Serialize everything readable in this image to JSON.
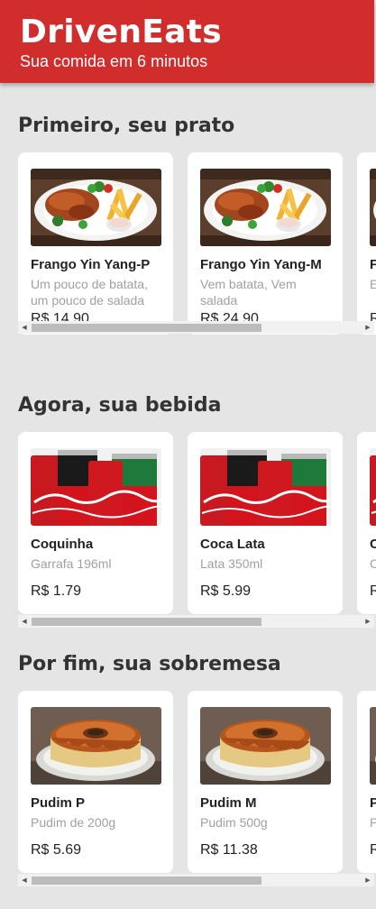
{
  "header": {
    "brand": "DrivenEats",
    "tagline": "Sua comida em 6 minutos"
  },
  "sections": [
    {
      "title": "Primeiro, seu prato",
      "items": [
        {
          "name": "Frango Yin Yang-P",
          "description": "Um pouco de batata, um pouco de salada",
          "price": "R$ 14.90",
          "image": "chicken-plate"
        },
        {
          "name": "Frango Yin Yang-M",
          "description": "Vem batata, Vem salada",
          "price": "R$ 24.90",
          "image": "chicken-plate"
        },
        {
          "name": "F",
          "description": "E b",
          "price": "R",
          "image": "chicken-plate"
        }
      ]
    },
    {
      "title": "Agora, sua bebida",
      "items": [
        {
          "name": "Coquinha",
          "description": "Garrafa 196ml",
          "price": "R$ 1.79",
          "image": "coke-cans"
        },
        {
          "name": "Coca Lata",
          "description": "Lata 350ml",
          "price": "R$ 5.99",
          "image": "coke-cans"
        },
        {
          "name": "C",
          "description": "C",
          "price": "R",
          "image": "coke-cans"
        }
      ]
    },
    {
      "title": "Por fim, sua sobremesa",
      "items": [
        {
          "name": "Pudim P",
          "description": "Pudim de 200g",
          "price": "R$ 5.69",
          "image": "pudding"
        },
        {
          "name": "Pudim M",
          "description": "Pudim 500g",
          "price": "R$ 11.38",
          "image": "pudding"
        },
        {
          "name": "P",
          "description": "P",
          "price": "R",
          "image": "pudding"
        }
      ]
    }
  ],
  "scrollbar": {
    "left_arrow": "◀",
    "right_arrow": "▶"
  },
  "colors": {
    "brand_red": "#d12d2d",
    "background": "#e5e5e5",
    "card": "#ffffff",
    "muted_text": "#a0a0a0"
  }
}
